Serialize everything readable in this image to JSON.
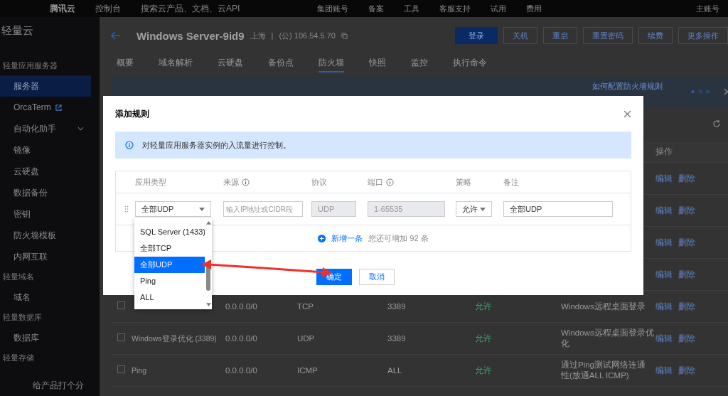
{
  "top_bar": {
    "logo": "腾讯云",
    "console": "控制台",
    "search_placeholder": "搜索云产品、文档、云API",
    "items": [
      "集团账号",
      "备案",
      "工具",
      "客服支持",
      "试用",
      "费用"
    ],
    "account": "主账号"
  },
  "sidebar": {
    "title": "轻量云",
    "sections": [
      {
        "heading": "轻量应用服务器",
        "items": [
          {
            "label": "服务器",
            "selected": true,
            "kind": "plain"
          },
          {
            "label": "OrcaTerm",
            "selected": false,
            "kind": "external"
          },
          {
            "label": "自动化助手",
            "selected": false,
            "kind": "expand"
          },
          {
            "label": "镜像",
            "selected": false,
            "kind": "plain"
          },
          {
            "label": "云硬盘",
            "selected": false,
            "kind": "plain"
          },
          {
            "label": "数据备份",
            "selected": false,
            "kind": "plain"
          },
          {
            "label": "密钥",
            "selected": false,
            "kind": "plain"
          },
          {
            "label": "防火墙模板",
            "selected": false,
            "kind": "plain"
          },
          {
            "label": "内网互联",
            "selected": false,
            "kind": "plain"
          }
        ]
      },
      {
        "heading": "轻量域名",
        "items": [
          {
            "label": "域名",
            "selected": false,
            "kind": "plain"
          }
        ]
      },
      {
        "heading": "轻量数据库",
        "items": [
          {
            "label": "数据库",
            "selected": false,
            "kind": "plain"
          }
        ]
      },
      {
        "heading": "轻量存储"
      }
    ],
    "feedback": "给产品打个分"
  },
  "instance": {
    "name": "Windows Server-9id9",
    "region": "上海",
    "separator": "|",
    "ip": "(公) 106.54.5.70"
  },
  "actions": [
    {
      "label": "登录",
      "primary": true
    },
    {
      "label": "关机",
      "primary": false
    },
    {
      "label": "重启",
      "primary": false
    },
    {
      "label": "重置密码",
      "primary": false
    },
    {
      "label": "续费",
      "primary": false
    },
    {
      "label": "更多操作",
      "primary": false
    }
  ],
  "tabs": [
    {
      "label": "概要",
      "selected": false
    },
    {
      "label": "域名解析",
      "selected": false
    },
    {
      "label": "云硬盘",
      "selected": false
    },
    {
      "label": "备份点",
      "selected": false
    },
    {
      "label": "防火墙",
      "selected": true
    },
    {
      "label": "快照",
      "selected": false
    },
    {
      "label": "监控",
      "selected": false
    },
    {
      "label": "执行命令",
      "selected": false
    }
  ],
  "banner": {
    "link": "如何配置防火墙规则"
  },
  "table": {
    "actions_header": "操作",
    "rows": [
      {
        "actions": [
          "编辑",
          "删除"
        ]
      },
      {
        "actions": [
          "编辑",
          "删除"
        ]
      },
      {
        "actions": [
          "编辑",
          "删除"
        ]
      },
      {
        "actions": [
          "编辑",
          "删除"
        ]
      },
      {
        "checked": false,
        "source": "0.0.0.0/0",
        "protocol": "TCP",
        "port": "3389",
        "policy": "允许",
        "note": "Windows远程桌面登录",
        "actions": [
          "编辑",
          "删除"
        ]
      },
      {
        "checked": false,
        "name": "Windows登录优化 (3389)",
        "source": "0.0.0.0/0",
        "protocol": "UDP",
        "port": "3389",
        "policy": "允许",
        "note": "Windows远程桌面登录优化",
        "actions": [
          "编辑",
          "删除"
        ]
      },
      {
        "checked": false,
        "name": "Ping",
        "source": "0.0.0.0/0",
        "protocol": "ICMP",
        "port": "ALL",
        "policy": "允许",
        "note": "通过Ping测试网络连通性(放通ALL ICMP)",
        "actions": [
          "编辑",
          "删除"
        ]
      }
    ]
  },
  "modal": {
    "title": "添加规则",
    "info": "对轻量应用服务器实例的入流量进行控制。",
    "columns": [
      {
        "label": "应用类型",
        "help": false
      },
      {
        "label": "来源",
        "help": true
      },
      {
        "label": "协议",
        "help": false
      },
      {
        "label": "端口",
        "help": true
      },
      {
        "label": "策略",
        "help": false
      },
      {
        "label": "备注",
        "help": false
      }
    ],
    "row": {
      "type": "全部UDP",
      "source_placeholder": "输入IP地址或CIDR段",
      "protocol": "UDP",
      "port": "1-65535",
      "policy": "允许",
      "note": "全部UDP"
    },
    "add": {
      "label": "新增一条",
      "hint": "您还可增加 92 条"
    },
    "buttons": [
      {
        "label": "确定",
        "primary": true
      },
      {
        "label": "取消",
        "primary": false
      }
    ],
    "dropdown": [
      {
        "label": "SQL Server (1433)",
        "selected": false
      },
      {
        "label": "全部TCP",
        "selected": false
      },
      {
        "label": "全部UDP",
        "selected": true
      },
      {
        "label": "Ping",
        "selected": false
      },
      {
        "label": "ALL",
        "selected": false
      }
    ]
  }
}
